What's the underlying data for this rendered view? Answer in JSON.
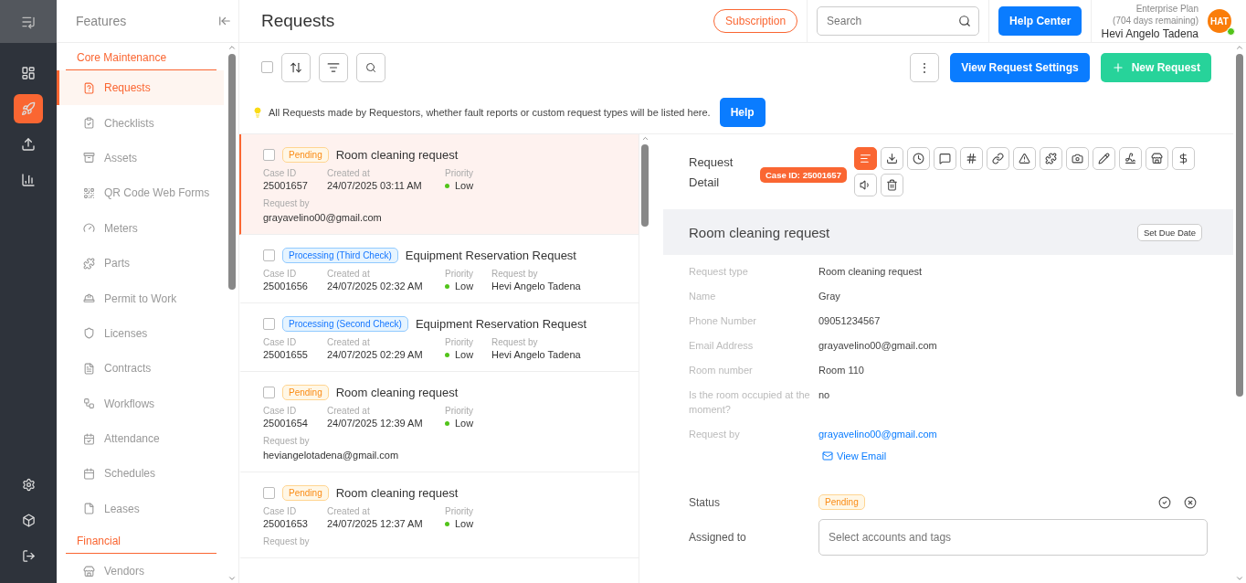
{
  "rail": {
    "items": [
      {
        "selected": false
      },
      {
        "selected": true
      },
      {
        "selected": false
      },
      {
        "selected": false
      }
    ]
  },
  "sidebar": {
    "title": "Features",
    "sections": [
      {
        "title": "Core Maintenance",
        "items": [
          {
            "label": "Requests",
            "selected": true
          },
          {
            "label": "Checklists",
            "selected": false
          },
          {
            "label": "Assets",
            "selected": false
          },
          {
            "label": "QR Code Web Forms",
            "selected": false
          },
          {
            "label": "Meters",
            "selected": false
          },
          {
            "label": "Parts",
            "selected": false
          },
          {
            "label": "Permit to Work",
            "selected": false
          },
          {
            "label": "Licenses",
            "selected": false
          },
          {
            "label": "Contracts",
            "selected": false
          },
          {
            "label": "Workflows",
            "selected": false
          },
          {
            "label": "Attendance",
            "selected": false
          },
          {
            "label": "Schedules",
            "selected": false
          },
          {
            "label": "Leases",
            "selected": false
          }
        ]
      },
      {
        "title": "Financial",
        "items": [
          {
            "label": "Vendors",
            "selected": false
          }
        ]
      }
    ]
  },
  "header": {
    "title": "Requests",
    "subscription": "Subscription",
    "search": {
      "placeholder": "Search"
    },
    "help_center": "Help Center",
    "plan": "Enterprise Plan",
    "plan_remaining": "(704 days remaining)",
    "user": "Hevi Angelo Tadena",
    "avatar": "HAT",
    "online": true
  },
  "toolbar": {
    "select_all": false,
    "more": "⋮",
    "settings_button": "View Request Settings",
    "new_button": "New Request"
  },
  "info": {
    "text": "All Requests made by Requestors, whether fault reports or custom request types will be listed here.",
    "button": "Help"
  },
  "requests": [
    {
      "selected": true,
      "checked": false,
      "status": {
        "label": "Pending",
        "kind": "pending"
      },
      "title": "Room cleaning request",
      "kind": "stacked",
      "case_label": "Case ID",
      "case_id": "25001657",
      "created_label": "Created at",
      "created_at": "24/07/2025 03:11 AM",
      "priority_label": "Priority",
      "priority": "Low",
      "request_by_label": "Request by",
      "request_by": "grayavelino00@gmail.com"
    },
    {
      "selected": false,
      "checked": false,
      "status": {
        "label": "Processing (Third Check)",
        "kind": "processing"
      },
      "title": "Equipment Reservation Request",
      "kind": "inline",
      "case_label": "Case ID",
      "case_id": "25001656",
      "created_label": "Created at",
      "created_at": "24/07/2025 02:32 AM",
      "priority_label": "Priority",
      "priority": "Low",
      "request_by_label": "Request by",
      "request_by": "Hevi Angelo Tadena"
    },
    {
      "selected": false,
      "checked": false,
      "status": {
        "label": "Processing (Second Check)",
        "kind": "processing"
      },
      "title": "Equipment Reservation Request",
      "kind": "inline",
      "case_label": "Case ID",
      "case_id": "25001655",
      "created_label": "Created at",
      "created_at": "24/07/2025 02:29 AM",
      "priority_label": "Priority",
      "priority": "Low",
      "request_by_label": "Request by",
      "request_by": "Hevi Angelo Tadena"
    },
    {
      "selected": false,
      "checked": false,
      "status": {
        "label": "Pending",
        "kind": "pending"
      },
      "title": "Room cleaning request",
      "kind": "stacked",
      "case_label": "Case ID",
      "case_id": "25001654",
      "created_label": "Created at",
      "created_at": "24/07/2025 12:39 AM",
      "priority_label": "Priority",
      "priority": "Low",
      "request_by_label": "Request by",
      "request_by": "heviangelotadena@gmail.com"
    },
    {
      "selected": false,
      "checked": false,
      "status": {
        "label": "Pending",
        "kind": "pending"
      },
      "title": "Room cleaning request",
      "kind": "stacked",
      "case_label": "Case ID",
      "case_id": "25001653",
      "created_label": "Created at",
      "created_at": "24/07/2025 12:37 AM",
      "priority_label": "Priority",
      "priority": "Low",
      "request_by_label": "Request by"
    }
  ],
  "detail": {
    "heading": "Request Detail",
    "case_badge": "Case ID: 25001657",
    "tools": [
      {
        "selected": true
      },
      {
        "selected": false
      },
      {
        "selected": false
      },
      {
        "selected": false
      },
      {
        "selected": false
      },
      {
        "selected": false
      },
      {
        "selected": false
      },
      {
        "selected": false
      },
      {
        "selected": false
      },
      {
        "selected": false
      },
      {
        "selected": false
      },
      {
        "selected": false
      },
      {
        "selected": false
      },
      {
        "selected": false
      },
      {
        "selected": false
      }
    ],
    "title": "Room cleaning request",
    "due_button": "Set Due Date",
    "fields": [
      {
        "label": "Request type",
        "value": "Room cleaning request",
        "kind": "text"
      },
      {
        "label": "Name",
        "value": "Gray",
        "kind": "text"
      },
      {
        "label": "Phone Number",
        "value": "09051234567",
        "kind": "text"
      },
      {
        "label": "Email Address",
        "value": "grayavelino00@gmail.com",
        "kind": "text"
      },
      {
        "label": "Room number",
        "value": "Room 110",
        "kind": "text"
      },
      {
        "label": "Is the room occupied at the moment?",
        "value": "no",
        "kind": "text"
      },
      {
        "label": "Request by",
        "value": "grayavelino00@gmail.com",
        "kind": "link",
        "action": "View Email"
      }
    ],
    "status_label": "Status",
    "status": {
      "label": "Pending",
      "kind": "pending"
    },
    "assigned_label": "Assigned to",
    "assigned": {
      "placeholder": "Select accounts and tags"
    }
  }
}
